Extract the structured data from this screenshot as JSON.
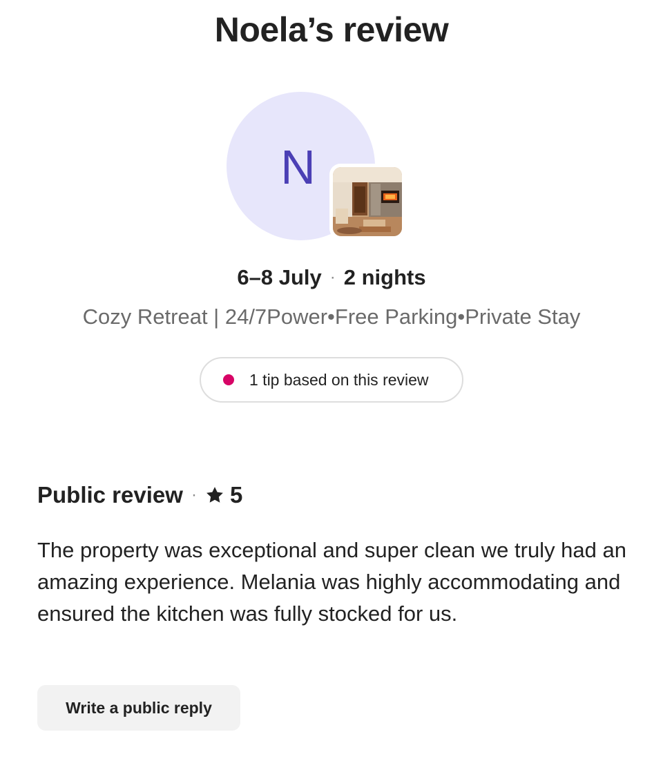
{
  "page": {
    "title": "Noela’s review"
  },
  "guest": {
    "initial": "N",
    "avatar_color": "#e7e6fb",
    "initial_color": "#4b3fb5"
  },
  "stay": {
    "dates": "6–8 July",
    "separator": "·",
    "nights": "2 nights",
    "listing_name": "Cozy Retreat | 24/7Power•Free Parking•Private Stay"
  },
  "tip": {
    "text": "1 tip based on this review",
    "dot_color": "#d70466"
  },
  "public_review": {
    "heading": "Public review",
    "separator": "·",
    "rating": "5",
    "rating_icon": "star-icon",
    "text": "The property was exceptional and super clean we truly had an amazing experience. Melania was highly accommodating and ensured the kitchen was fully stocked for us."
  },
  "actions": {
    "reply_label": "Write a public reply"
  }
}
